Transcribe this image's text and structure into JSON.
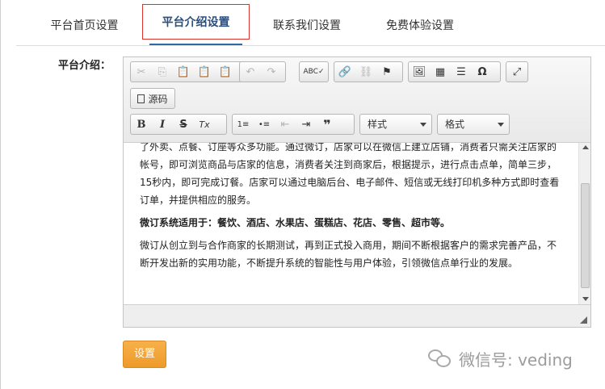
{
  "tabs": [
    {
      "label": "平台首页设置"
    },
    {
      "label": "平台介绍设置"
    },
    {
      "label": "联系我们设置"
    },
    {
      "label": "免费体验设置"
    }
  ],
  "form": {
    "field_label": "平台介绍：",
    "submit_label": "设置"
  },
  "editor": {
    "source_label": "源码",
    "style_combo": "样式",
    "format_combo": "格式",
    "icons": {
      "cut": "✂",
      "copy": "⎘",
      "paste": "📋",
      "paste_text": "📋",
      "paste_word": "📋",
      "undo": "↶",
      "redo": "↷",
      "spellcheck": "ABC✓",
      "link": "🔗",
      "unlink": "⛓",
      "anchor": "⚑",
      "image": "🖼",
      "table": "▦",
      "hr": "☰",
      "special_char": "Ω",
      "maximize": "⤢",
      "bold": "B",
      "italic": "I",
      "strike": "S",
      "remove_format": "Tx",
      "ordered_list": "1≡",
      "bullet_list": "•≡",
      "outdent": "⇤",
      "indent": "⇥",
      "blockquote": "❞"
    },
    "content": [
      "了外卖、点餐、订座等众多功能。通过微订，店家可以在微信上建立店铺，消费者只需关注店家的帐号，即可浏览商品与店家的信息，消费者关注到商家后，根据提示，进行点击点单，简单三步，15秒内，即可完成订餐。店家可以通过电脑后台、电子邮件、短信或无线打印机多种方式即时查看订单，并提供相应的服务。",
      "微订系统适用于：餐饮、酒店、水果店、蛋糕店、花店、零售、超市等。",
      "微订从创立到与合作商家的长期测试，再到正式投入商用，期间不断根据客户的需求完善产品，不断开发出新的实用功能，不断提升系统的智能性与用户体验，引领微信点单行业的发展。"
    ]
  },
  "watermark": {
    "text": "微信号: veding"
  }
}
